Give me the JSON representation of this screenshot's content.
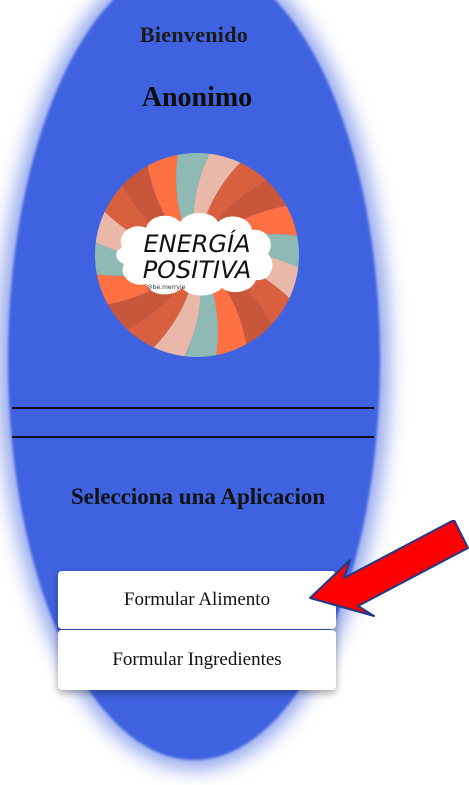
{
  "header": {
    "welcome": "Bienvenido",
    "username": "Anonimo"
  },
  "logo": {
    "line1": "ENERGÍA",
    "line2": "POSITIVA",
    "credit": "@be.merryie"
  },
  "menu": {
    "heading": "Selecciona una Aplicacion",
    "buttons": [
      {
        "label": "Formular Alimento"
      },
      {
        "label": "Formular Ingredientes"
      }
    ]
  },
  "colors": {
    "panel": "#3f63e0",
    "arrow": "#ff0000",
    "logo_stripes": [
      "#c8563a",
      "#ff7043",
      "#8fb9b5",
      "#e9b8a8",
      "#d9603f"
    ]
  }
}
